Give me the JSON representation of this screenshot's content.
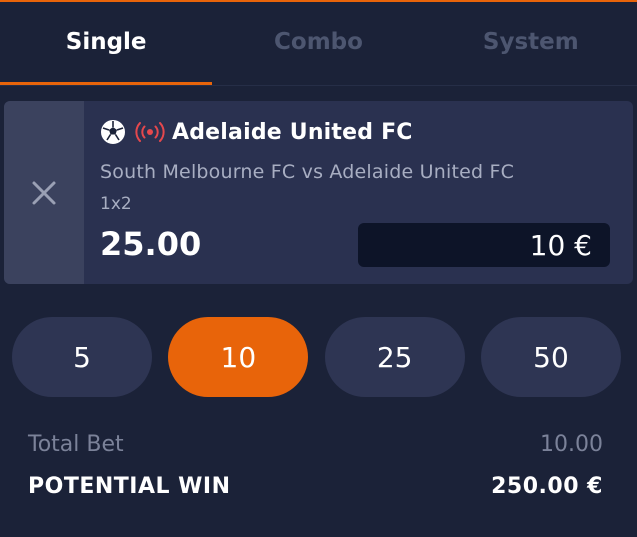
{
  "tabs": [
    {
      "label": "Single",
      "active": true
    },
    {
      "label": "Combo",
      "active": false
    },
    {
      "label": "System",
      "active": false
    }
  ],
  "bet": {
    "selection": "Adelaide United FC",
    "match": "South Melbourne FC vs Adelaide United FC",
    "market": "1x2",
    "odds": "25.00",
    "stake": "10 €",
    "icons": {
      "sport": "soccer-ball-icon",
      "live": "live-broadcast-icon",
      "remove": "close-icon"
    }
  },
  "quick_stakes": [
    "5",
    "10",
    "25",
    "50"
  ],
  "quick_stakes_selected": "10",
  "summary": {
    "total_label": "Total Bet",
    "total_value": "10.00",
    "win_label": "POTENTIAL WIN",
    "win_value": "250.00 €"
  },
  "colors": {
    "accent": "#e8640a",
    "background": "#1b2238",
    "card": "#2a3150",
    "live": "#e5484d"
  }
}
